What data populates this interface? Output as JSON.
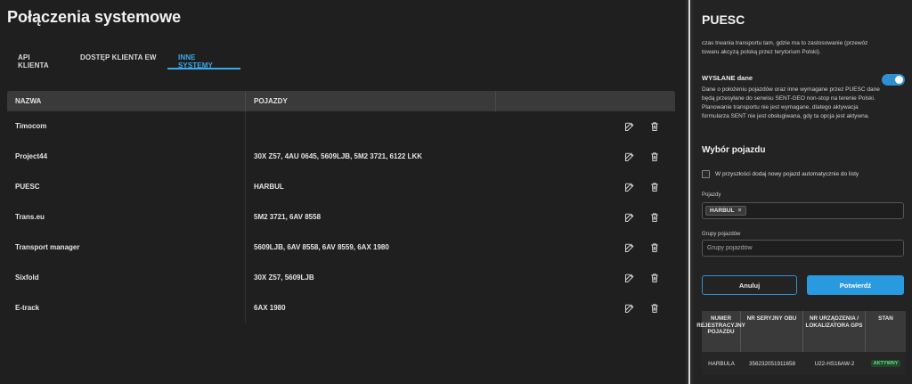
{
  "page": {
    "title": "Połączenia systemowe"
  },
  "tabs": [
    {
      "label": "API KLIENTA",
      "active": false
    },
    {
      "label": "DOSTĘP KLIENTA EW",
      "active": false
    },
    {
      "label": "INNE SYSTEMY",
      "active": true
    }
  ],
  "table": {
    "headers": {
      "name": "NAZWA",
      "vehicles": "POJAZDY"
    },
    "rows": [
      {
        "name": "Timocom",
        "vehicles": ""
      },
      {
        "name": "Project44",
        "vehicles": "30X Z57, 4AU 0645, 5609LJB, 5M2 3721, 6122 LKK"
      },
      {
        "name": "PUESC",
        "vehicles": "HARBUL"
      },
      {
        "name": "Trans.eu",
        "vehicles": "5M2 3721, 6AV 8558"
      },
      {
        "name": "Transport manager",
        "vehicles": "5609LJB, 6AV 8558, 6AV 8559, 6AX 1980"
      },
      {
        "name": "Sixfold",
        "vehicles": "30X Z57, 5609LJB"
      },
      {
        "name": "E-track",
        "vehicles": "6AX 1980"
      }
    ],
    "row_icons": [
      "edit-icon",
      "trash-icon"
    ]
  },
  "panel": {
    "title": "PUESC",
    "intro_text": "czas trwania transportu tam, gdzie ma to zastosowanie (przewóz towaru akcyzą polską przez terytorium Polski).",
    "sent_label": "WYSŁANE dane",
    "sent_toggle_on": true,
    "sent_text": "Dane o położeniu pojazdów oraz inne wymagane przez PUESC dane będą przesyłane do serwisu SENT-GEO non-stop na terenie Polski. Planowanie transportu nie jest wymagane, dlatego aktywacja formularza SENT nie jest obsługiwana, gdy ta opcja jest aktywna.",
    "section_title": "Wybór pojazdu",
    "checkbox_label": "W przyszłości dodaj nowy pojazd automatycznie do listy",
    "checkbox_checked": false,
    "vehicles_label": "Pojazdy",
    "vehicle_chip": "HARBUL",
    "chip_remove": "×",
    "groups_label": "Grupy pojazdów",
    "groups_placeholder": "Grupy pojazdów",
    "cancel_label": "Anuluj",
    "confirm_label": "Potwierdź",
    "accent_color": "#2a9ae0",
    "mini_table": {
      "headers": [
        "NUMER REJESTRACYJNY POJAZDU",
        "NR SERYJNY OBU",
        "NR URZĄDZENIA / LOKALIZATORA GPS",
        "STAN"
      ],
      "rows": [
        {
          "reg": "HARBULA",
          "serial": "356232051911658",
          "device": "U22-HS16AW-2",
          "status": "AKTYWNY"
        }
      ]
    }
  }
}
